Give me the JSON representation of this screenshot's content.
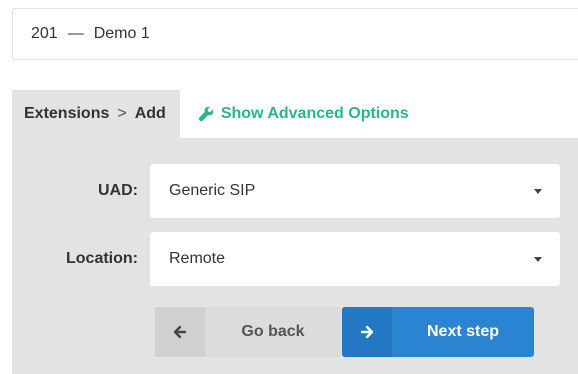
{
  "header": {
    "extension_number": "201",
    "separator": "—",
    "extension_name": "Demo 1"
  },
  "breadcrumb": {
    "section": "Extensions",
    "separator": ">",
    "current": "Add"
  },
  "advanced_options": {
    "label": "Show Advanced Options",
    "icon": "wrench-icon",
    "color": "#2bb58f"
  },
  "form": {
    "uad": {
      "label": "UAD:",
      "value": "Generic SIP"
    },
    "location": {
      "label": "Location:",
      "value": "Remote"
    }
  },
  "actions": {
    "back_label": "Go back",
    "back_icon": "arrow-left-icon",
    "next_label": "Next step",
    "next_icon": "arrow-right-icon",
    "next_color": "#2a84d2"
  }
}
